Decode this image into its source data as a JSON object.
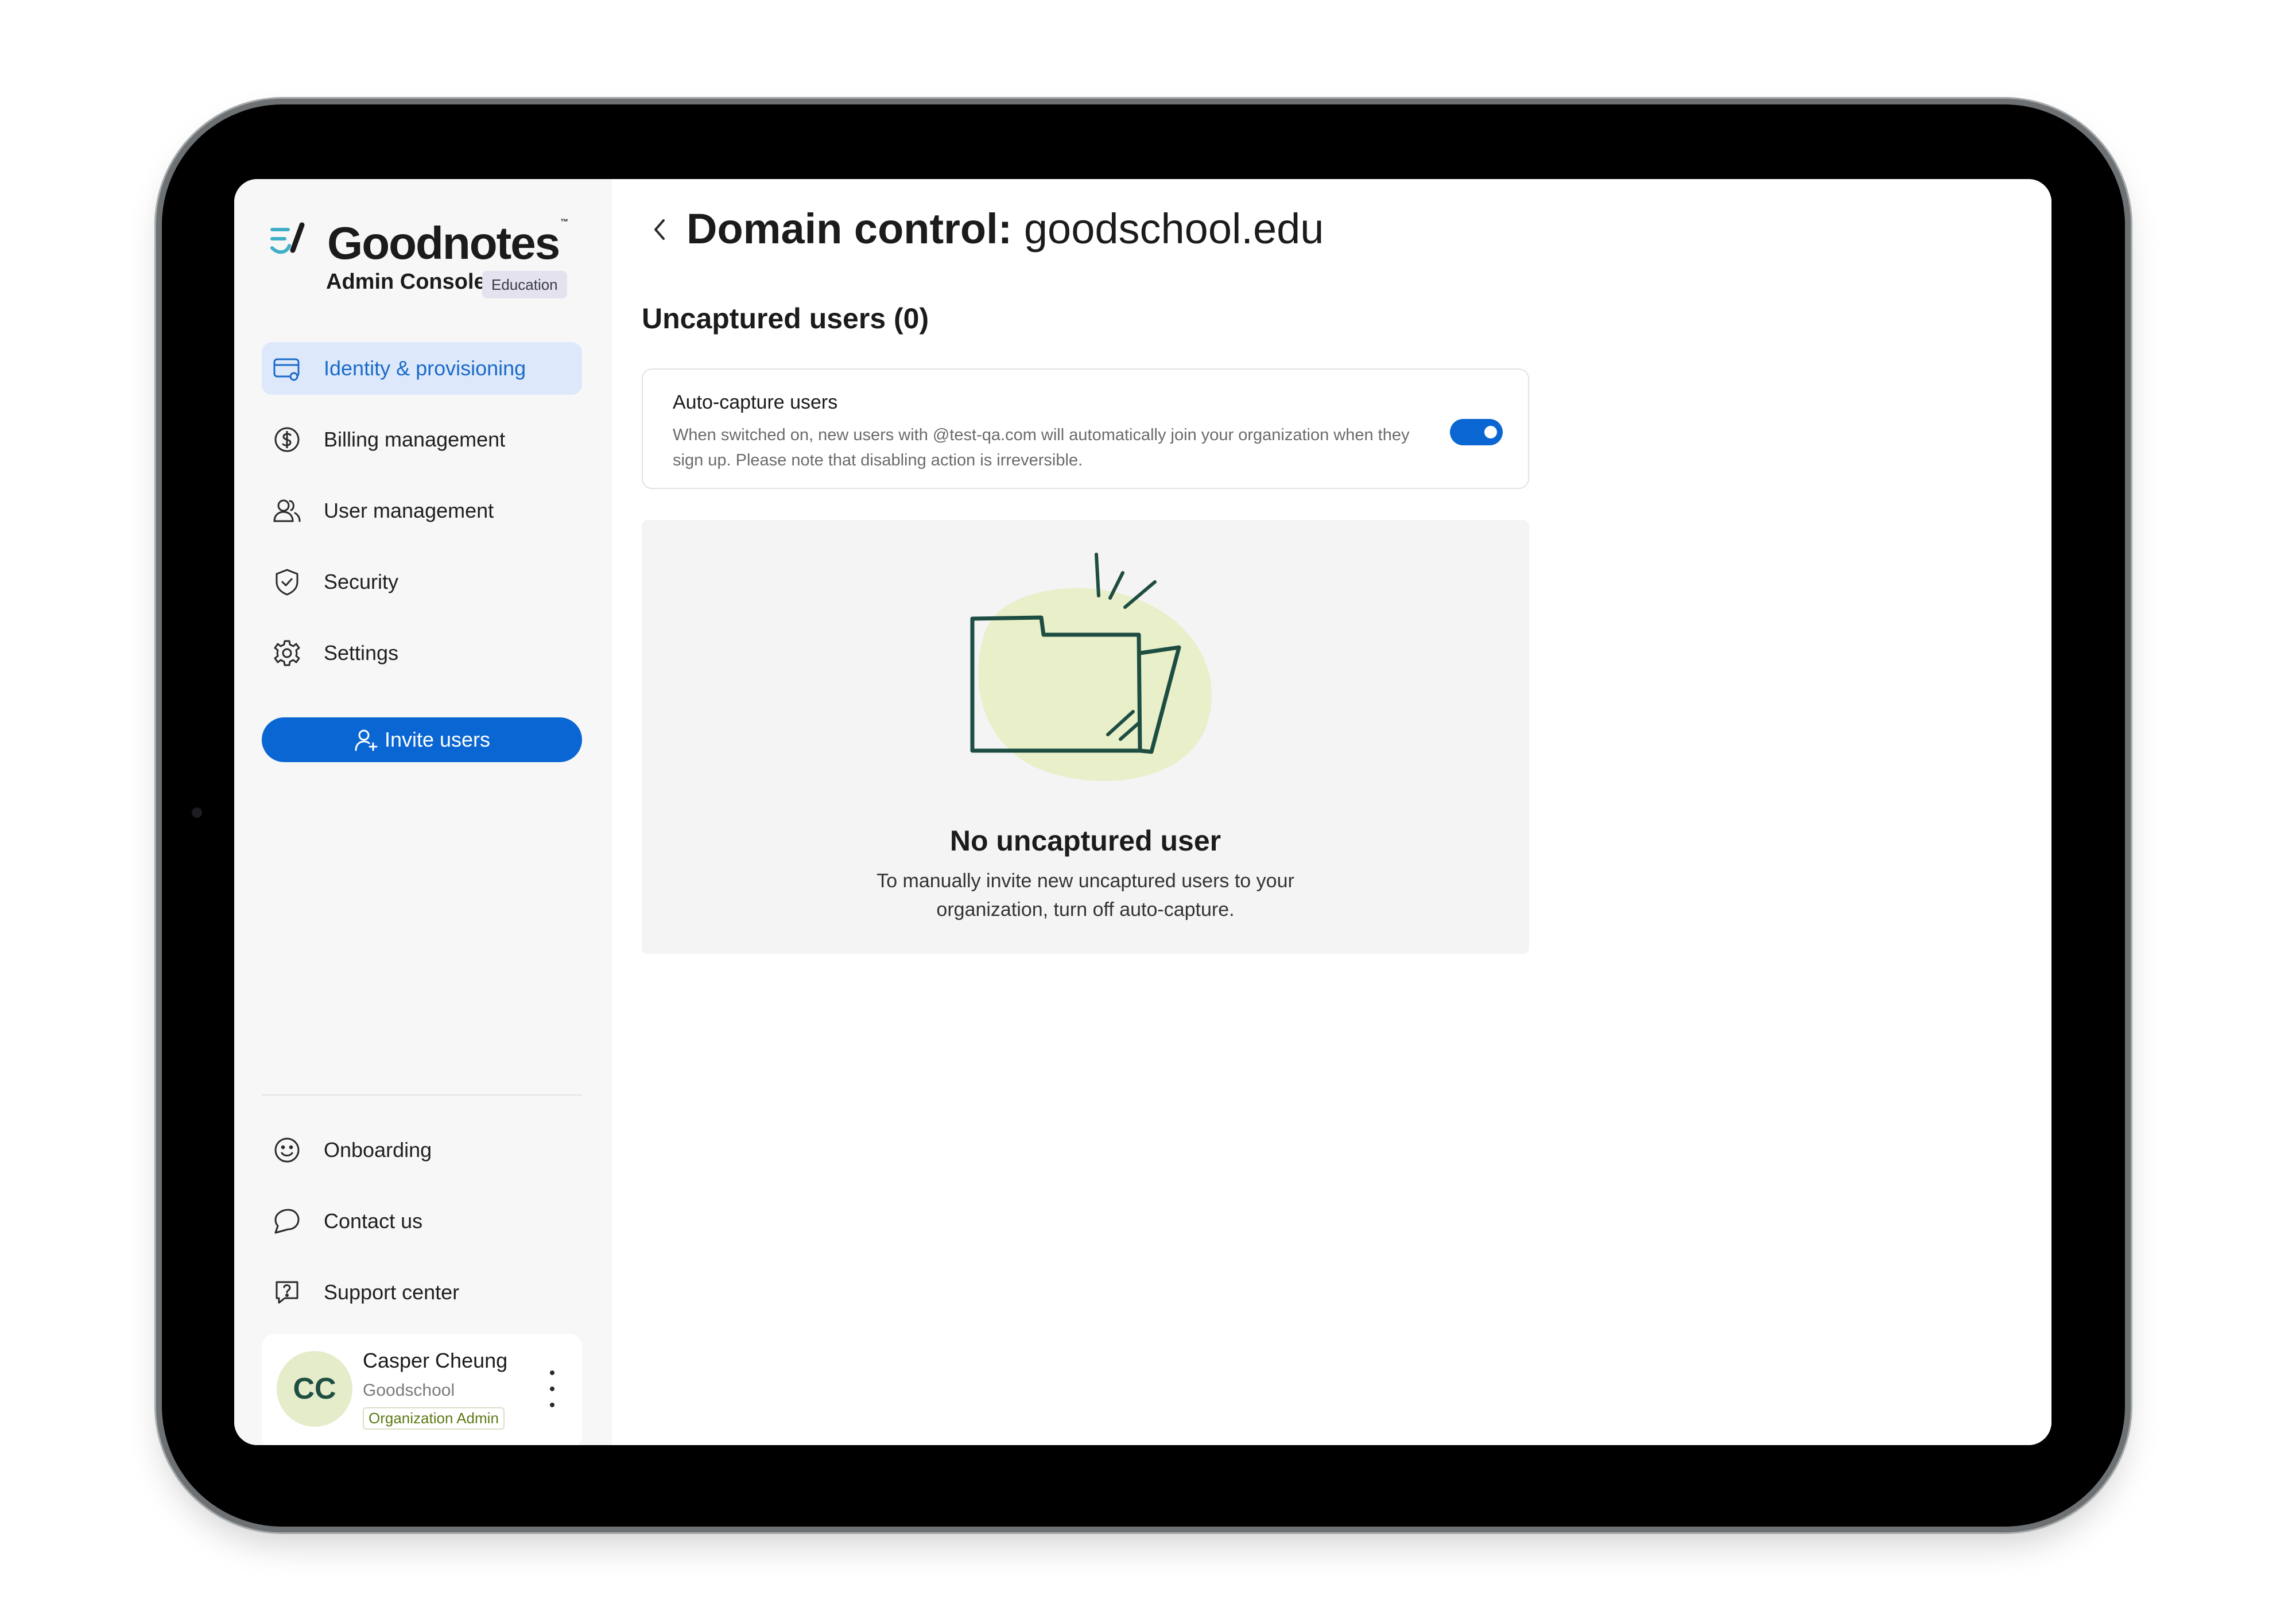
{
  "app": {
    "brand": "Goodnotes",
    "trademark": "™",
    "console_label": "Admin Console",
    "edition_badge": "Education"
  },
  "sidebar": {
    "items": [
      {
        "label": "Identity & provisioning",
        "icon": "id-card-icon",
        "active": true
      },
      {
        "label": "Billing management",
        "icon": "dollar-circle-icon",
        "active": false
      },
      {
        "label": "User management",
        "icon": "users-icon",
        "active": false
      },
      {
        "label": "Security",
        "icon": "shield-check-icon",
        "active": false
      },
      {
        "label": "Settings",
        "icon": "gear-icon",
        "active": false
      }
    ],
    "invite_button": "Invite users",
    "secondary_items": [
      {
        "label": "Onboarding",
        "icon": "smiley-icon"
      },
      {
        "label": "Contact us",
        "icon": "chat-bubble-icon"
      },
      {
        "label": "Support center",
        "icon": "help-chat-icon"
      }
    ]
  },
  "profile": {
    "initials": "CC",
    "name": "Casper Cheung",
    "organization": "Goodschool",
    "role": "Organization Admin"
  },
  "main": {
    "title_prefix": "Domain control:",
    "title_domain": "goodschool.edu",
    "section_title": "Uncaptured users (0)",
    "auto_capture": {
      "title": "Auto-capture users",
      "description": "When switched on, new users with @test-qa.com will automatically join your organization when they sign up. Please note that disabling action is irreversible.",
      "enabled": true
    },
    "empty_state": {
      "title": "No uncaptured user",
      "description": "To manually invite new uncaptured users to your organization, turn off auto-capture."
    }
  },
  "colors": {
    "accent": "#0a66d2",
    "active_nav_bg": "#dde9fb",
    "avatar_bg": "#e4ecc9",
    "illustration_green": "#1e4d42",
    "illustration_blob": "#e8efc9"
  }
}
